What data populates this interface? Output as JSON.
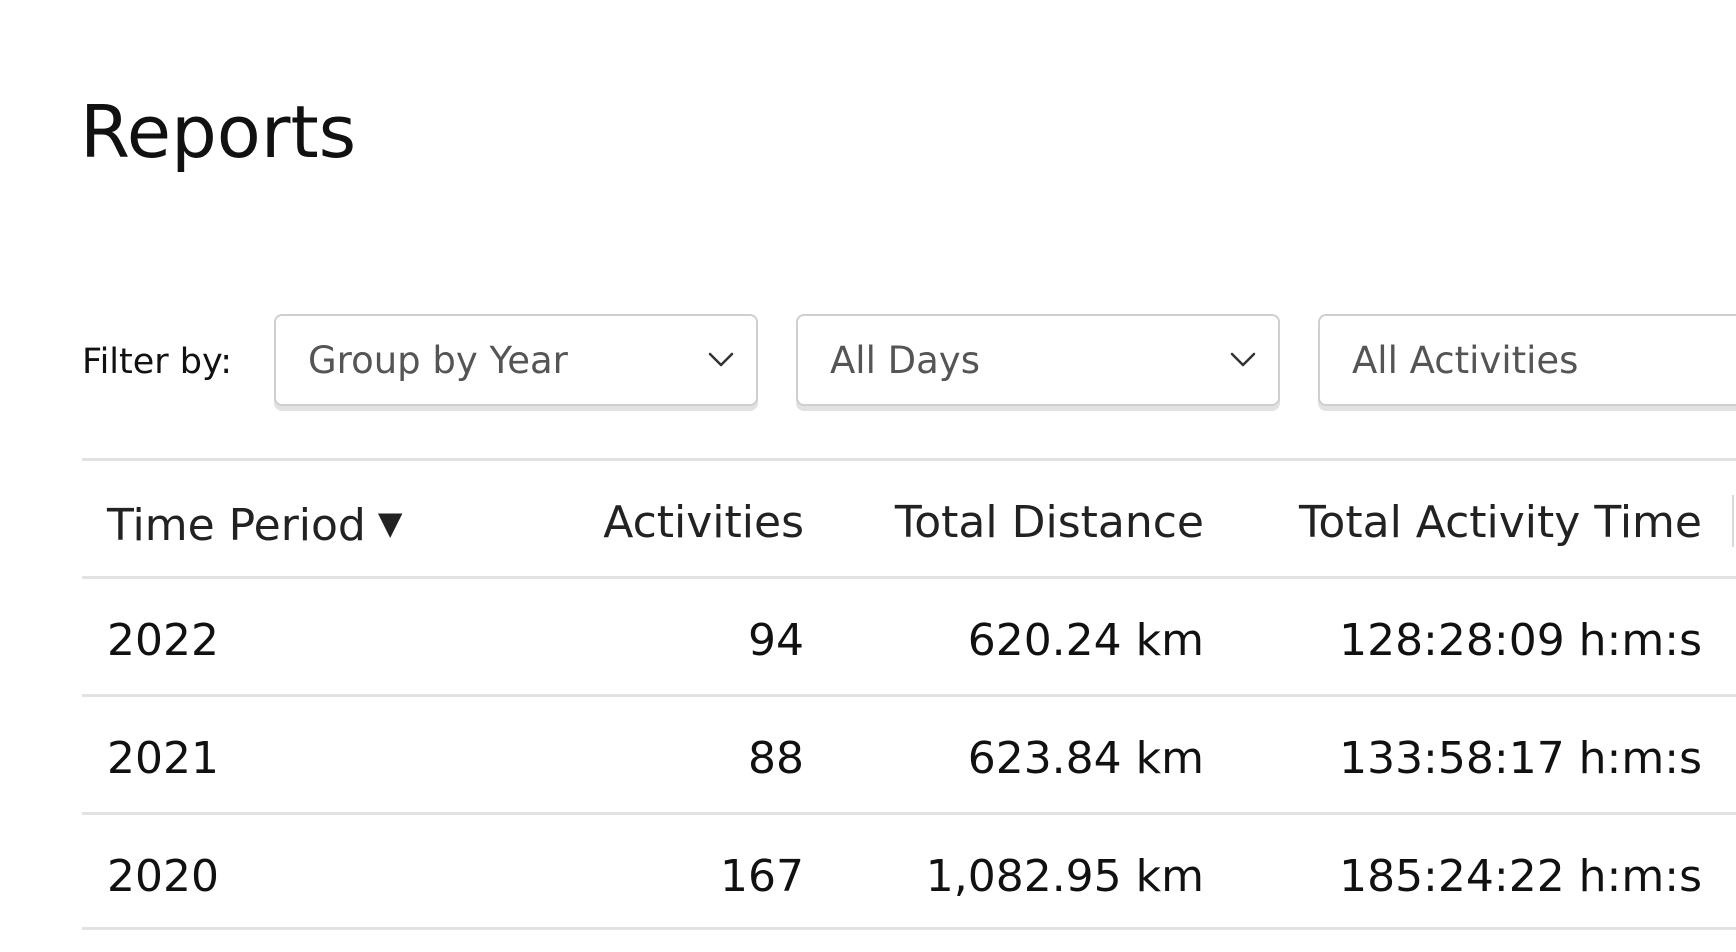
{
  "page": {
    "title": "Reports"
  },
  "filters": {
    "label": "Filter by:",
    "group_by": {
      "selected": "Group by Year",
      "icon": "chevron-down-icon"
    },
    "days": {
      "selected": "All Days",
      "icon": "chevron-down-icon"
    },
    "activities": {
      "selected": "All Activities"
    }
  },
  "table": {
    "headers": {
      "time_period": "Time Period",
      "sort_indicator": "▼",
      "activities": "Activities",
      "total_distance": "Total Distance",
      "total_activity_time": "Total Activity Time"
    },
    "rows": [
      {
        "time_period": "2022",
        "activities": "94",
        "total_distance": "620.24 km",
        "total_activity_time": "128:28:09 h:m:s"
      },
      {
        "time_period": "2021",
        "activities": "88",
        "total_distance": "623.84 km",
        "total_activity_time": "133:58:17 h:m:s"
      },
      {
        "time_period": "2020",
        "activities": "167",
        "total_distance": "1,082.95 km",
        "total_activity_time": "185:24:22 h:m:s"
      }
    ]
  }
}
